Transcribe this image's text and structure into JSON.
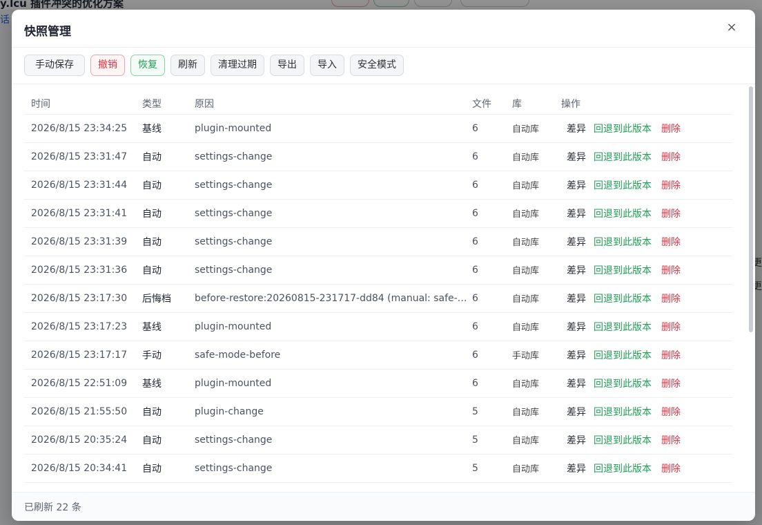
{
  "background": {
    "title": "y.lcu  插件冲突的优化方案",
    "tab": "话",
    "right_text_1": "更",
    "right_text_2": "更"
  },
  "modal": {
    "title": "快照管理",
    "close_label": "×"
  },
  "toolbar": {
    "manual_save": "手动保存",
    "undo": "撤销",
    "restore": "恢复",
    "refresh": "刷新",
    "clean_expired": "清理过期",
    "export": "导出",
    "import": "导入",
    "safe_mode": "安全模式"
  },
  "table": {
    "headers": [
      "时间",
      "类型",
      "原因",
      "文件",
      "库",
      "操作"
    ],
    "action_labels": {
      "diff": "差异",
      "rollback": "回退到此版本",
      "delete": "删除"
    },
    "rows": [
      {
        "time": "2026/8/15 23:34:25",
        "type": "基线",
        "reason": "plugin-mounted",
        "files": "6",
        "lib": "自动库"
      },
      {
        "time": "2026/8/15 23:31:47",
        "type": "自动",
        "reason": "settings-change",
        "files": "6",
        "lib": "自动库"
      },
      {
        "time": "2026/8/15 23:31:44",
        "type": "自动",
        "reason": "settings-change",
        "files": "6",
        "lib": "自动库"
      },
      {
        "time": "2026/8/15 23:31:41",
        "type": "自动",
        "reason": "settings-change",
        "files": "6",
        "lib": "自动库"
      },
      {
        "time": "2026/8/15 23:31:39",
        "type": "自动",
        "reason": "settings-change",
        "files": "6",
        "lib": "自动库"
      },
      {
        "time": "2026/8/15 23:31:36",
        "type": "自动",
        "reason": "settings-change",
        "files": "6",
        "lib": "自动库"
      },
      {
        "time": "2026/8/15 23:17:30",
        "type": "后悔档",
        "reason": "before-restore:20260815-231717-dd84 (manual: safe-m…",
        "files": "6",
        "lib": "自动库"
      },
      {
        "time": "2026/8/15 23:17:23",
        "type": "基线",
        "reason": "plugin-mounted",
        "files": "6",
        "lib": "自动库"
      },
      {
        "time": "2026/8/15 23:17:17",
        "type": "手动",
        "reason": "safe-mode-before",
        "files": "6",
        "lib": "手动库"
      },
      {
        "time": "2026/8/15 22:51:09",
        "type": "基线",
        "reason": "plugin-mounted",
        "files": "6",
        "lib": "自动库"
      },
      {
        "time": "2026/8/15 21:55:50",
        "type": "自动",
        "reason": "plugin-change",
        "files": "5",
        "lib": "自动库"
      },
      {
        "time": "2026/8/15 20:35:24",
        "type": "自动",
        "reason": "settings-change",
        "files": "5",
        "lib": "自动库"
      },
      {
        "time": "2026/8/15 20:34:41",
        "type": "自动",
        "reason": "settings-change",
        "files": "5",
        "lib": "自动库"
      }
    ]
  },
  "footer": {
    "status": "已刷新 22 条"
  }
}
